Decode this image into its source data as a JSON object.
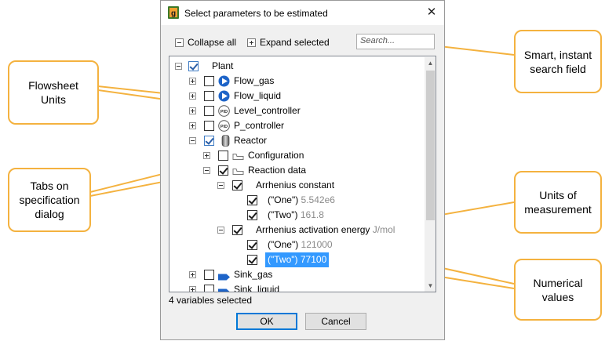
{
  "dialog": {
    "title": "Select parameters to be estimated",
    "close_glyph": "✕",
    "toolbar": {
      "collapse_all": "Collapse all",
      "expand_selected": "Expand selected"
    },
    "search": {
      "placeholder": "Search..."
    },
    "tree": [
      {
        "label": "Plant",
        "checked": true,
        "icon": "plant-checkbox"
      },
      {
        "label": "Flow_gas",
        "checked": false,
        "icon": "flow-icon"
      },
      {
        "label": "Flow_liquid",
        "checked": false,
        "icon": "flow-icon"
      },
      {
        "label": "Level_controller",
        "checked": false,
        "icon": "pid-icon",
        "icon_text": "PID"
      },
      {
        "label": "P_controller",
        "checked": false,
        "icon": "pid-icon",
        "icon_text": "PID"
      },
      {
        "label": "Reactor",
        "checked": true,
        "icon": "reactor-icon"
      },
      {
        "label": "Configuration",
        "checked": false,
        "icon": "tab-icon"
      },
      {
        "label": "Reaction data",
        "checked": true,
        "icon": "tab-icon"
      },
      {
        "label": "Arrhenius constant",
        "checked": true,
        "unit": ""
      },
      {
        "label": "(\"One\")",
        "value": "5.542e6",
        "checked": true
      },
      {
        "label": "(\"Two\")",
        "value": "161.8",
        "checked": true
      },
      {
        "label": "Arrhenius activation energy",
        "unit": "J/mol",
        "checked": true
      },
      {
        "label": "(\"One\")",
        "value": "121000",
        "checked": true
      },
      {
        "label": "(\"Two\")",
        "value": "77100",
        "checked": true,
        "selected": true
      },
      {
        "label": "Sink_gas",
        "checked": false,
        "icon": "sink-icon"
      },
      {
        "label": "Sink_liquid",
        "checked": false,
        "icon": "sink-icon"
      }
    ],
    "status": "4 variables selected",
    "ok_label": "OK",
    "cancel_label": "Cancel"
  },
  "callouts": {
    "flowsheet_units": "Flowsheet Units",
    "tabs": "Tabs on specification dialog",
    "search": "Smart, instant search field",
    "units": "Units of measurement",
    "values": "Numerical values"
  },
  "colors": {
    "accent": "#f4b23f",
    "selection": "#3399ff",
    "flow_blue": "#1e64c8"
  }
}
